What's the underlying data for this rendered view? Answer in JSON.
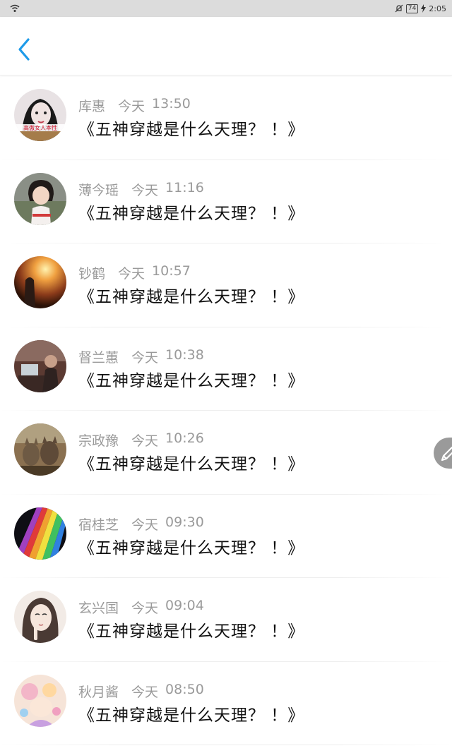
{
  "status_bar": {
    "time": "2:05",
    "battery": "74"
  },
  "messages": [
    {
      "name": "库惠",
      "day": "今天",
      "time": "13:50",
      "title": "《五神穿越是什么天理？ ！》",
      "avatar_text": "高傲女人本性"
    },
    {
      "name": "薄今瑶",
      "day": "今天",
      "time": "11:16",
      "title": "《五神穿越是什么天理？ ！》"
    },
    {
      "name": "钞鹤",
      "day": "今天",
      "time": "10:57",
      "title": "《五神穿越是什么天理？ ！》"
    },
    {
      "name": "督兰蕙",
      "day": "今天",
      "time": "10:38",
      "title": "《五神穿越是什么天理？ ！》"
    },
    {
      "name": "宗政豫",
      "day": "今天",
      "time": "10:26",
      "title": "《五神穿越是什么天理？ ！》"
    },
    {
      "name": "宿桂芝",
      "day": "今天",
      "time": "09:30",
      "title": "《五神穿越是什么天理？ ！》"
    },
    {
      "name": "玄兴国",
      "day": "今天",
      "time": "09:04",
      "title": "《五神穿越是什么天理？ ！》"
    },
    {
      "name": "秋月酱",
      "day": "今天",
      "time": "08:50",
      "title": "《五神穿越是什么天理？ ！》"
    }
  ],
  "icons": {
    "back": "chevron-left-icon",
    "edit": "pencil-icon"
  },
  "colors": {
    "accent": "#1e9be9",
    "secondary_text": "#9a9a9a",
    "primary_text": "#111111"
  }
}
